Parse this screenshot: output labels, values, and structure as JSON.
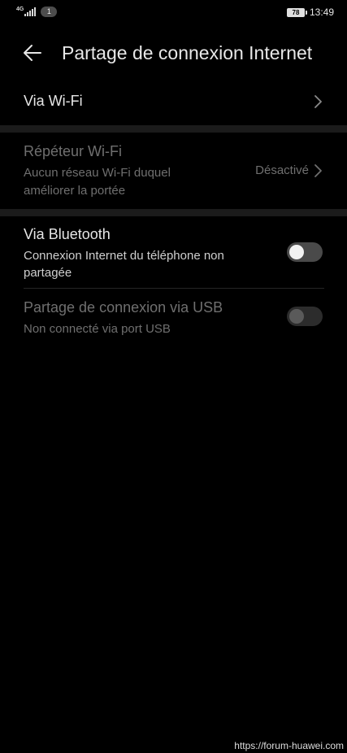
{
  "status_bar": {
    "network_type": "4G",
    "notification_count": "1",
    "battery_level": "78",
    "time": "13:49"
  },
  "header": {
    "title": "Partage de connexion Internet"
  },
  "wifi_hotspot": {
    "title": "Via Wi-Fi"
  },
  "wifi_repeater": {
    "title": "Répéteur Wi-Fi",
    "subtitle_line1": "Aucun réseau Wi-Fi duquel",
    "subtitle_line2": "améliorer la portée",
    "value": "Désactivé"
  },
  "bluetooth": {
    "title": "Via Bluetooth",
    "subtitle_line1": "Connexion Internet du téléphone non",
    "subtitle_line2": "partagée",
    "toggle_on": false
  },
  "usb": {
    "title": "Partage de connexion via USB",
    "subtitle": "Non connecté via port USB",
    "toggle_on": false,
    "enabled": false
  },
  "watermark": "https://forum-huawei.com",
  "colors": {
    "background": "#000000",
    "section_gap": "#1b1b1b",
    "text_primary": "#e6e6e6",
    "text_disabled": "#6f6f6f"
  }
}
